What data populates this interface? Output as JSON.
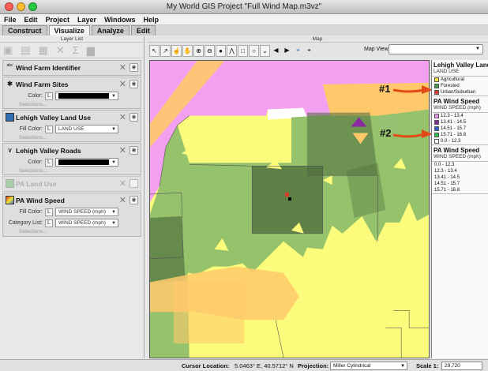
{
  "window": {
    "title": "My World GIS Project \"Full Wind Map.m3vz\""
  },
  "menu": [
    "File",
    "Edit",
    "Project",
    "Layer",
    "Windows",
    "Help"
  ],
  "tabs": [
    "Construct",
    "Visualize",
    "Analyze",
    "Edit"
  ],
  "active_tab": "Visualize",
  "layer_list": {
    "title": "Layer List",
    "selections_label": "Selections...",
    "layers": [
      {
        "name": "Wind Farm Identifier"
      },
      {
        "name": "Wind Farm Sites",
        "field_label": "Color:",
        "color": "#000000"
      },
      {
        "name": "Lehigh Valley Land Use",
        "field_label": "Fill Color:",
        "value": "LAND USE"
      },
      {
        "name": "Lehigh Valley Roads",
        "field_label": "Color:",
        "color": "#000000"
      },
      {
        "name": "PA Land Use"
      },
      {
        "name": "PA Wind Speed",
        "fill_label": "Fill Color:",
        "fill_value": "WIND SPEED (mph)",
        "category_label": "Category List:",
        "category_value": "WIND SPEED (mph)"
      }
    ]
  },
  "map": {
    "panel_title": "Map",
    "map_view_label": "Map View:",
    "callouts": [
      "#1",
      "#2"
    ]
  },
  "legend": {
    "groups": [
      {
        "title": "Lehigh Valley Land",
        "sub": "LAND USE",
        "items": [
          {
            "label": "Agricultural",
            "color": "#f2e23a"
          },
          {
            "label": "Forested",
            "color": "#3f9e45"
          },
          {
            "label": "Urban/Suburban",
            "color": "#e03a2a"
          }
        ]
      },
      {
        "title": "PA Wind Speed",
        "sub": "WIND SPEED (mph)",
        "items": [
          {
            "label": "12.3 - 13.4",
            "color": "#f08ef0"
          },
          {
            "label": "13.41 - 14.5",
            "color": "#8a2aa0"
          },
          {
            "label": "14.51 - 15.7",
            "color": "#2a5dc8"
          },
          {
            "label": "15.71 - 16.8",
            "color": "#34c04a"
          },
          {
            "label": "0.0 - 12.3",
            "color": "#ffffff"
          }
        ]
      },
      {
        "title": "PA Wind Speed",
        "sub": "WIND SPEED (mph)",
        "plain": [
          "0.0 - 12.3",
          "12.3 - 13.4",
          "13.41 - 14.5",
          "14.51 - 15.7",
          "15.71 - 16.8"
        ]
      }
    ]
  },
  "status": {
    "cursor_label": "Cursor Location:",
    "cursor_value": "5.0463° E, 40.5712° N",
    "projection_label": "Projection:",
    "projection_value": "Miller Cylindrical",
    "scale_label": "Scale 1:",
    "scale_value": "29,720"
  },
  "colors": {
    "pink": "#f4a0f0",
    "green": "#8fbf6a",
    "yellow": "#fcfc7c",
    "orange": "#ffc96b",
    "dark_green": "#4d6b3c",
    "arrow": "#e24a18"
  }
}
